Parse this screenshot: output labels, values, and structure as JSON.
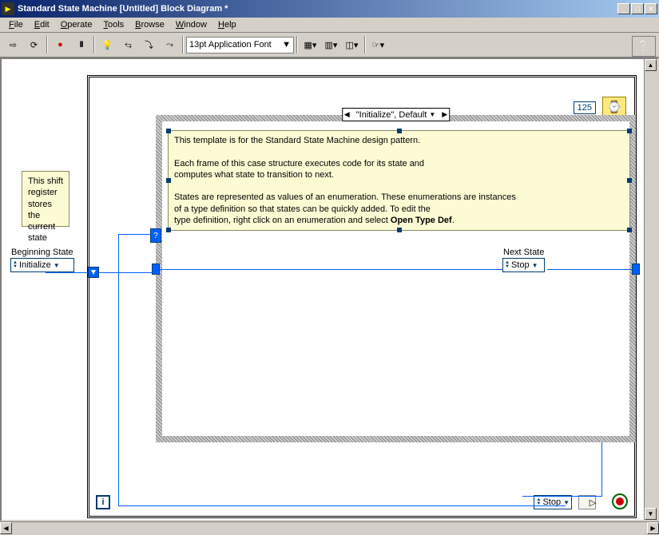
{
  "window": {
    "title": "Standard State Machine [Untitled] Block Diagram *"
  },
  "menu": {
    "file": "File",
    "edit": "Edit",
    "operate": "Operate",
    "tools": "Tools",
    "browse": "Browse",
    "window": "Window",
    "help": "Help"
  },
  "toolbar": {
    "font": "13pt Application Font"
  },
  "while_loop": {
    "wait_ms": "125",
    "iteration_label": "i",
    "shift_register_note": "This shift register stores the current state"
  },
  "case": {
    "selector_value": "\"Initialize\", Default",
    "note_line1": "This template is for the Standard State Machine design pattern.",
    "note_line2": "Each frame of this case structure executes code for its state and",
    "note_line3": "computes what state to transition to next.",
    "note_line4": "States are represented as values of an enumeration. These enumerations are instances",
    "note_line5": "of a type definition so that states can be quickly added. To edit the",
    "note_line6a": "type definition, right click on an enumeration and select ",
    "note_line6b": "Open Type Def",
    "note_line6c": "."
  },
  "beginning_state": {
    "label": "Beginning State",
    "value": "Initialize"
  },
  "next_state": {
    "label": "Next State",
    "value": "Stop"
  },
  "stop_compare": {
    "value": "Stop"
  }
}
